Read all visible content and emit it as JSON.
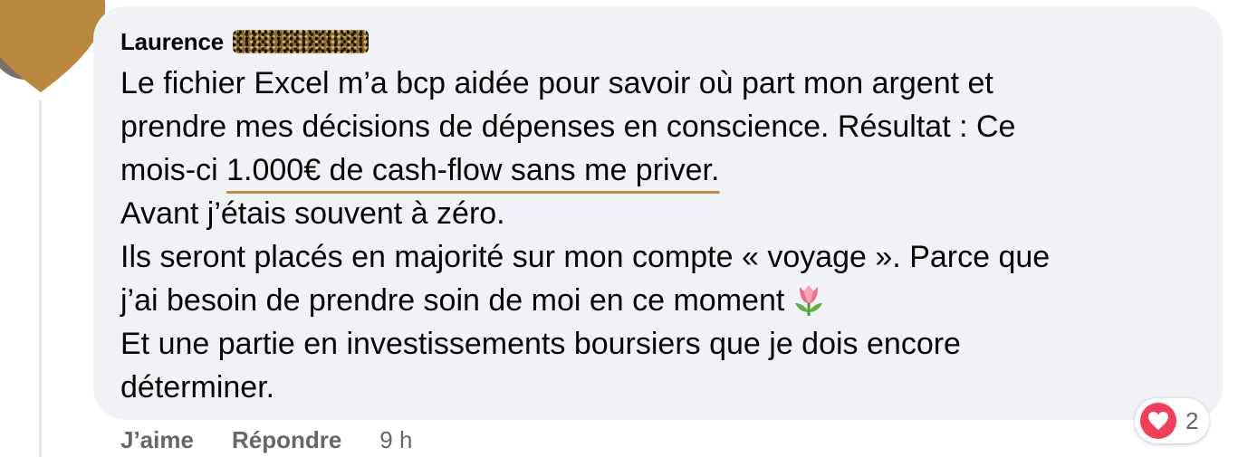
{
  "comment": {
    "author": "Laurence",
    "lines": [
      "Le fichier Excel m’a bcp aidée pour savoir où part mon argent et",
      "prendre mes décisions de dépenses en conscience. Résultat : Ce"
    ],
    "line3_prefix": "mois-ci ",
    "line3_underlined": "1.000€ de cash-flow sans me priver.",
    "line4": "Avant j’étais souvent à zéro.",
    "line5": "Ils seront placés en majorité sur mon compte « voyage ». Parce que",
    "line6": "j’ai besoin de prendre soin de moi en ce moment",
    "line6_emoji": "tulip",
    "line7": "Et une partie en investissements boursiers que je dois encore",
    "line8": "déterminer."
  },
  "actions": {
    "like_label": "J’aime",
    "reply_label": "Répondre",
    "time": "9 h"
  },
  "reaction": {
    "icon": "heart-icon",
    "count": "2",
    "color": "#f33e58"
  },
  "colors": {
    "bubble": "#f0f2f5",
    "underline": "#b88f39",
    "sticker": "#b8893e",
    "meta_text": "#65676b"
  }
}
